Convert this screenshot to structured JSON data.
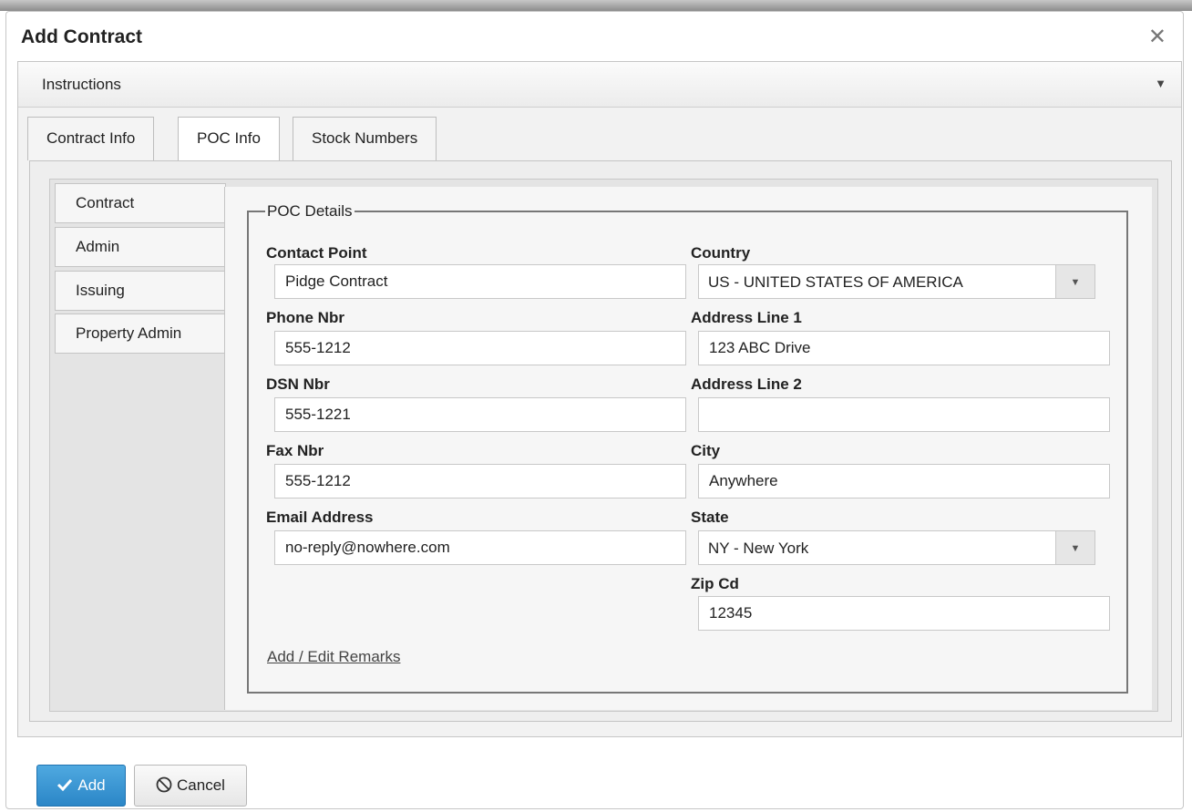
{
  "dialog": {
    "title": "Add Contract",
    "close_icon": "close-icon"
  },
  "instructions": {
    "label": "Instructions",
    "toggle_icon": "triangle-down-icon"
  },
  "tabs": [
    {
      "label": "Contract Info",
      "active": false
    },
    {
      "label": "POC Info",
      "active": true
    },
    {
      "label": "Stock Numbers",
      "active": false
    }
  ],
  "vertical_tabs": [
    {
      "label": "Contract",
      "active": true
    },
    {
      "label": "Admin",
      "active": false
    },
    {
      "label": "Issuing",
      "active": false
    },
    {
      "label": "Property Admin",
      "active": false
    }
  ],
  "poc_details": {
    "legend": "POC Details",
    "contact_point": {
      "label": "Contact Point",
      "value": "Pidge Contract"
    },
    "phone_nbr": {
      "label": "Phone Nbr",
      "value": "555-1212"
    },
    "dsn_nbr": {
      "label": "DSN Nbr",
      "value": "555-1221"
    },
    "fax_nbr": {
      "label": "Fax Nbr",
      "value": "555-1212"
    },
    "email_address": {
      "label": "Email Address",
      "value": "no-reply@nowhere.com"
    },
    "country": {
      "label": "Country",
      "value": "US - UNITED STATES OF AMERICA"
    },
    "address_line_1": {
      "label": "Address Line 1",
      "value": "123 ABC Drive"
    },
    "address_line_2": {
      "label": "Address Line 2",
      "value": ""
    },
    "city": {
      "label": "City",
      "value": "Anywhere"
    },
    "state": {
      "label": "State",
      "value": "NY - New York"
    },
    "zip_cd": {
      "label": "Zip Cd",
      "value": "12345"
    },
    "remarks_link": "Add / Edit Remarks"
  },
  "buttons": {
    "add": {
      "label": "Add",
      "icon": "checkmark-icon"
    },
    "cancel": {
      "label": "Cancel",
      "icon": "prohibited-icon"
    }
  },
  "colors": {
    "primary_button": "#2b86c7"
  }
}
